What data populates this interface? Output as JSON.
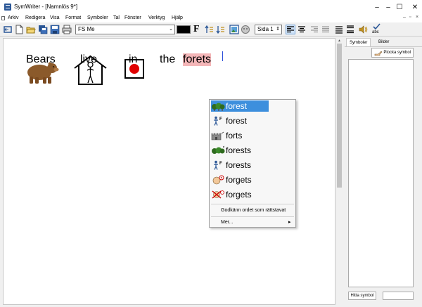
{
  "window": {
    "title": "SymWriter - [Namnlös 9*]",
    "minimize": "–",
    "maximize": "☐",
    "close": "✕"
  },
  "menubar": {
    "items": [
      "Arkiv",
      "Redigera",
      "Visa",
      "Format",
      "Symboler",
      "Tal",
      "Fönster",
      "Verktyg",
      "Hjälp"
    ],
    "mdi_controls": [
      "–",
      "▫",
      "×"
    ]
  },
  "toolbar": {
    "font_name": "FS Me",
    "page_label": "Sida 1",
    "spell_label": "abc"
  },
  "panel": {
    "tabs": [
      "Symboler",
      "Bilder"
    ],
    "pick_button": "Plocka symbol",
    "find_button": "Hitta symbol"
  },
  "document": {
    "words": [
      "Bears",
      "live",
      "in",
      "the",
      "forets"
    ]
  },
  "popup": {
    "suggestions": [
      "forest",
      "forest",
      "forts",
      "forests",
      "forests",
      "forgets",
      "forgets"
    ],
    "accept_label": "Godkänn ordet som rättstavat",
    "more_label": "Mer...",
    "more_arrow": "▸"
  },
  "colors": {
    "accent": "#3d8fdd",
    "misspelled_highlight": "#f4b6b8",
    "caret": "#2a4dd9"
  }
}
